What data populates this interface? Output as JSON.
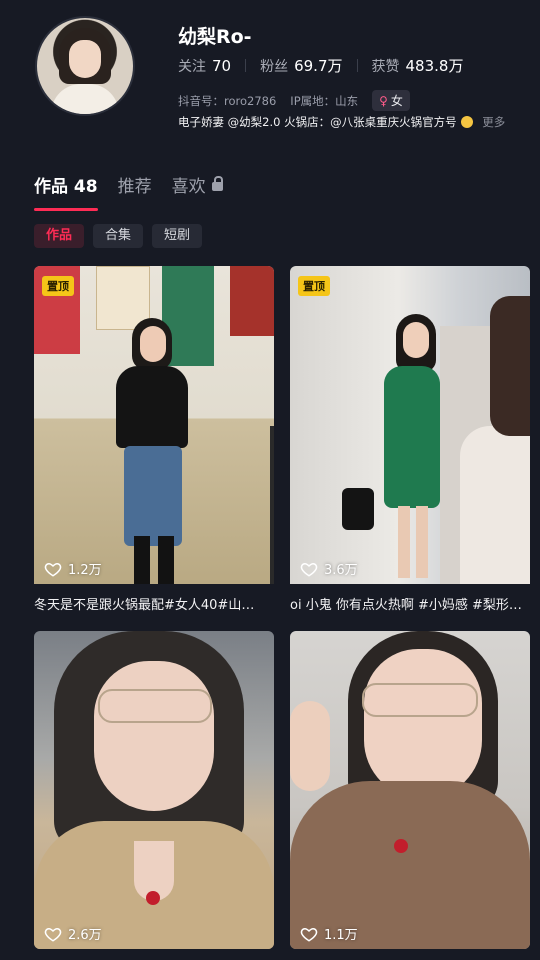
{
  "profile": {
    "name": "幼梨Ro-",
    "stats": [
      {
        "label": "关注",
        "value": "70"
      },
      {
        "label": "粉丝",
        "value": "69.7万"
      },
      {
        "label": "获赞",
        "value": "483.8万"
      }
    ],
    "douyin_id": "抖音号：roro2786",
    "ip": "IP属地：山东",
    "gender": "女",
    "bio": "电子娇妻 @幼梨2.0 火锅店：@八张桌重庆火锅官方号",
    "more": "更多"
  },
  "tabs": [
    {
      "label": "作品 48"
    },
    {
      "label": "推荐"
    },
    {
      "label": "喜欢"
    }
  ],
  "chips": [
    "作品",
    "合集",
    "短剧"
  ],
  "videos": [
    {
      "pinned": "置顶",
      "likes": "1.2万",
      "caption": "冬天是不是跟火锅最配#女人40#山…"
    },
    {
      "pinned": "置顶",
      "likes": "3.6万",
      "caption": "oi 小鬼 你有点火热啊 #小妈感 #梨形…"
    },
    {
      "likes": "2.6万"
    },
    {
      "likes": "1.1万"
    }
  ],
  "colors": {
    "accent": "#fe2c55",
    "background": "#171a24",
    "pin": "#f5c518"
  }
}
